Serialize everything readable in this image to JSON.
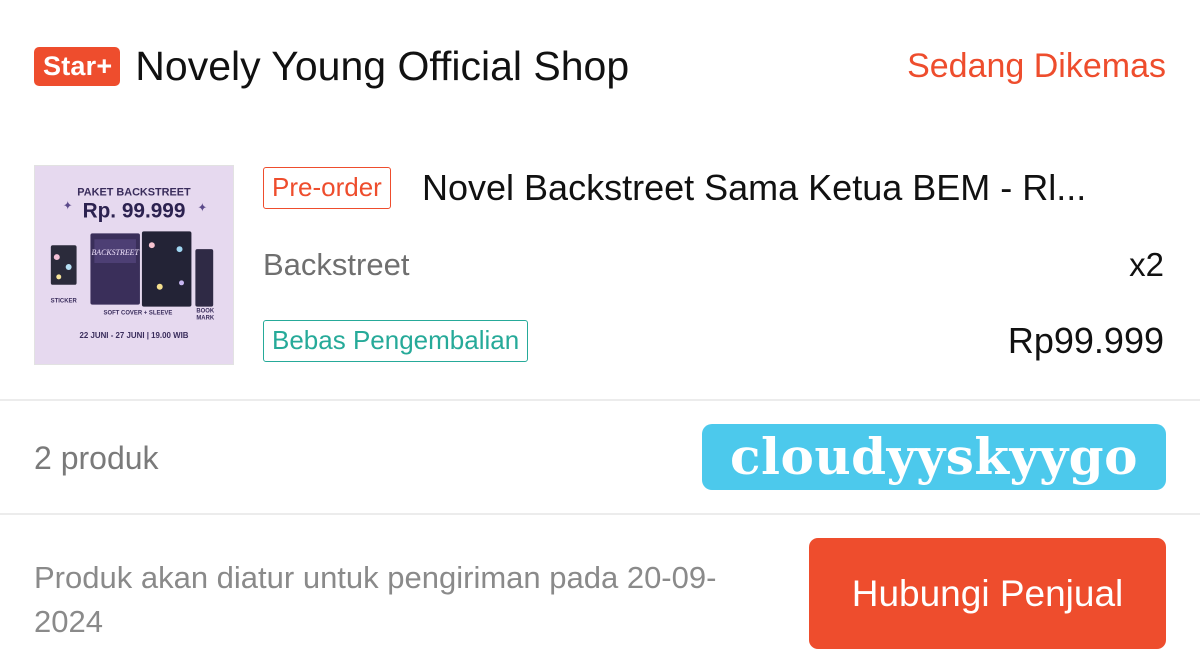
{
  "header": {
    "badge": "Star+",
    "shop_name": "Novely Young Official Shop",
    "status": "Sedang Dikemas"
  },
  "product": {
    "thumbnail": {
      "headline": "PAKET BACKSTREET",
      "price": "Rp. 99.999",
      "cover_title": "BACKSTREET",
      "label_sticker": "STICKER",
      "label_cover": "SOFT COVER + SLEEVE",
      "label_book": "BOOK",
      "label_mark": "MARK",
      "dates": "22 JUNI - 27 JUNI | 19.00 WIB"
    },
    "preorder_label": "Pre-order",
    "title": "Novel Backstreet Sama Ketua BEM - Rl...",
    "variant": "Backstreet",
    "quantity": "x2",
    "return_label": "Bebas Pengembalian",
    "price": "Rp99.999"
  },
  "summary": {
    "count": "2 produk",
    "watermark": "cloudyyskyygo"
  },
  "footer": {
    "shipping_note": "Produk akan diatur untuk pengiriman pada 20-09-2024",
    "contact_button": "Hubungi Penjual"
  },
  "colors": {
    "accent": "#ee4d2d",
    "teal": "#26aa99",
    "watermark_bg": "#4cc9ec"
  }
}
